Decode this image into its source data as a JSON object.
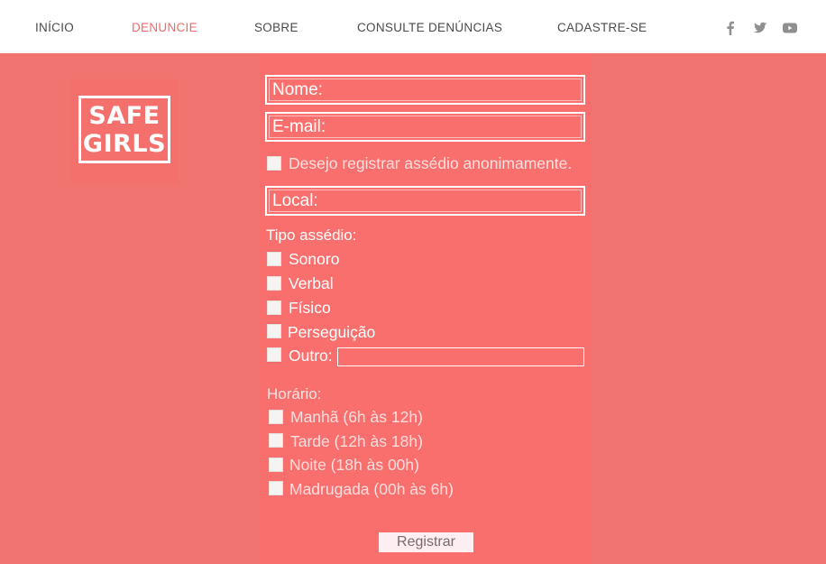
{
  "nav": {
    "items": [
      {
        "label": "INÍCIO",
        "active": false
      },
      {
        "label": "DENUNCIE",
        "active": true
      },
      {
        "label": "SOBRE",
        "active": false
      },
      {
        "label": "CONSULTE DENÚNCIAS",
        "active": false
      },
      {
        "label": "CADASTRE-SE",
        "active": false
      }
    ],
    "social": [
      "facebook-icon",
      "twitter-icon",
      "youtube-icon"
    ]
  },
  "logo": {
    "line1": "SAFE",
    "line2": "GIRLS"
  },
  "form": {
    "name_placeholder": "Nome:",
    "email_placeholder": "E-mail:",
    "anonymous_label": "Desejo registrar assédio anonimamente.",
    "location_placeholder": "Local:",
    "harassment_type": {
      "title": "Tipo assédio:",
      "options": [
        "Sonoro",
        "Verbal",
        "Físico",
        "Perseguição",
        "Outro:"
      ]
    },
    "time": {
      "title": "Horário:",
      "options": [
        "Manhã (6h às 12h)",
        "Tarde (12h às 18h)",
        "Noite (18h às 00h)",
        "Madrugada (00h às 6h)"
      ]
    },
    "submit_label": "Registrar"
  },
  "colors": {
    "background": "#f27471",
    "active_nav": "#ee6a68",
    "panel": "#f86f6d",
    "button": "#fdeef2"
  }
}
